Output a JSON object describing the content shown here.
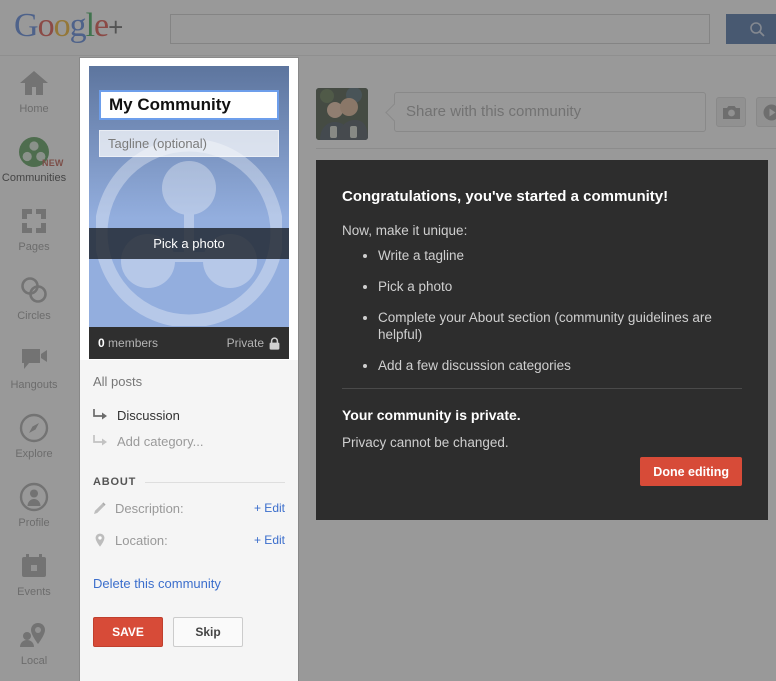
{
  "header": {
    "logo": {
      "g1": "G",
      "o1": "o",
      "o2": "o",
      "g2": "g",
      "l": "l",
      "e": "e",
      "plus": "+"
    },
    "search": {
      "value": "",
      "placeholder": ""
    },
    "search_button_icon": "search-icon"
  },
  "sidebar": {
    "items": [
      {
        "label": "Home",
        "icon": "home-icon",
        "active": false,
        "badge": ""
      },
      {
        "label": "Communities",
        "icon": "communities-icon",
        "active": true,
        "badge": "NEW"
      },
      {
        "label": "Pages",
        "icon": "pages-icon",
        "active": false,
        "badge": ""
      },
      {
        "label": "Circles",
        "icon": "circles-icon",
        "active": false,
        "badge": ""
      },
      {
        "label": "Hangouts",
        "icon": "hangouts-icon",
        "active": false,
        "badge": ""
      },
      {
        "label": "Explore",
        "icon": "explore-icon",
        "active": false,
        "badge": ""
      },
      {
        "label": "Profile",
        "icon": "profile-icon",
        "active": false,
        "badge": ""
      },
      {
        "label": "Events",
        "icon": "events-icon",
        "active": false,
        "badge": ""
      },
      {
        "label": "Local",
        "icon": "local-icon",
        "active": false,
        "badge": ""
      }
    ]
  },
  "share": {
    "placeholder": "Share with this community",
    "value": "",
    "camera_icon": "camera-icon",
    "video_icon": "video-icon",
    "avatar": "user-avatar-photo"
  },
  "community_card": {
    "name_value": "My Community",
    "tagline_placeholder": "Tagline (optional)",
    "pick_photo_label": "Pick a photo",
    "members_count": "0",
    "members_label": "members",
    "privacy_label": "Private",
    "privacy_icon": "lock-icon"
  },
  "categories": {
    "all_posts_label": "All posts",
    "items": [
      {
        "label": "Discussion",
        "icon": "arrow-branch-icon",
        "muted": false
      },
      {
        "label": "Add category...",
        "icon": "arrow-branch-icon",
        "muted": true
      }
    ]
  },
  "about": {
    "heading": "ABOUT",
    "rows": [
      {
        "label": "Description:",
        "icon": "pencil-icon",
        "action": "+ Edit"
      },
      {
        "label": "Location:",
        "icon": "map-pin-icon",
        "action": "+ Edit"
      }
    ],
    "delete_label": "Delete this community",
    "save_label": "SAVE",
    "skip_label": "Skip"
  },
  "tooltip": {
    "title": "Congratulations, you've started a community!",
    "lead": "Now, make it unique:",
    "bullets": [
      "Write a tagline",
      "Pick a photo",
      "Complete your About section (community guidelines are helpful)",
      "Add a few discussion categories"
    ],
    "privacy_title": "Your community is private.",
    "privacy_note": "Privacy cannot be changed.",
    "done_label": "Done editing"
  },
  "background_fragments": {
    "f1": "e",
    "f2": "r",
    "f3": "n"
  },
  "colors": {
    "accent_red": "#d74b38",
    "link_blue": "#3b6ecc",
    "search_blue": "#2b5797",
    "community_green": "#3a8c3a",
    "panel_dark": "#2d2d2d"
  }
}
